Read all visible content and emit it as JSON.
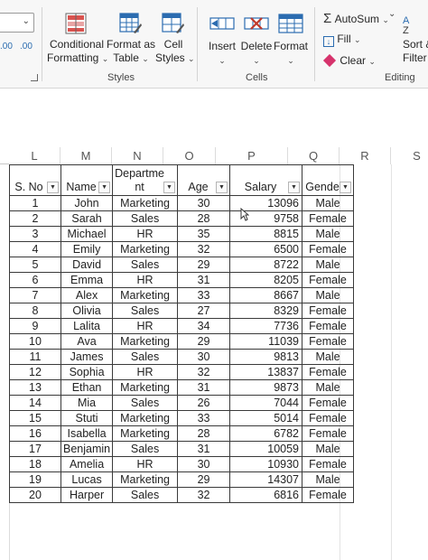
{
  "ribbon": {
    "conditional_formatting": {
      "line1": "Conditional",
      "line2": "Formatting"
    },
    "format_as_table": {
      "line1": "Format as",
      "line2": "Table"
    },
    "cell_styles": {
      "line1": "Cell",
      "line2": "Styles"
    },
    "styles_group_label": "Styles",
    "insert_label": "Insert",
    "delete_label": "Delete",
    "format_label": "Format",
    "cells_group_label": "Cells",
    "autosum_label": "AutoSum",
    "fill_label": "Fill",
    "clear_label": "Clear",
    "sort_filter": {
      "line1": "Sort &",
      "line2": "Filter"
    },
    "editing_group_label": "Editing",
    "number_format_partial": {
      "left": ".00",
      "right": ".00"
    }
  },
  "columns": [
    "L",
    "M",
    "N",
    "O",
    "P",
    "Q",
    "R",
    "S"
  ],
  "table": {
    "headers": [
      {
        "text": "S. No"
      },
      {
        "text": "Name"
      },
      {
        "line1": "Departme",
        "line2": "nt"
      },
      {
        "text": "Age"
      },
      {
        "text": "Salary"
      },
      {
        "text": "Gende"
      }
    ],
    "rows": [
      [
        "1",
        "John",
        "Marketing",
        "30",
        "13096",
        "Male"
      ],
      [
        "2",
        "Sarah",
        "Sales",
        "28",
        "9758",
        "Female"
      ],
      [
        "3",
        "Michael",
        "HR",
        "35",
        "8815",
        "Male"
      ],
      [
        "4",
        "Emily",
        "Marketing",
        "32",
        "6500",
        "Female"
      ],
      [
        "5",
        "David",
        "Sales",
        "29",
        "8722",
        "Male"
      ],
      [
        "6",
        "Emma",
        "HR",
        "31",
        "8205",
        "Female"
      ],
      [
        "7",
        "Alex",
        "Marketing",
        "33",
        "8667",
        "Male"
      ],
      [
        "8",
        "Olivia",
        "Sales",
        "27",
        "8329",
        "Female"
      ],
      [
        "9",
        "Lalita",
        "HR",
        "34",
        "7736",
        "Female"
      ],
      [
        "10",
        "Ava",
        "Marketing",
        "29",
        "11039",
        "Female"
      ],
      [
        "11",
        "James",
        "Sales",
        "30",
        "9813",
        "Male"
      ],
      [
        "12",
        "Sophia",
        "HR",
        "32",
        "13837",
        "Female"
      ],
      [
        "13",
        "Ethan",
        "Marketing",
        "31",
        "9873",
        "Male"
      ],
      [
        "14",
        "Mia",
        "Sales",
        "26",
        "7044",
        "Female"
      ],
      [
        "15",
        "Stuti",
        "Marketing",
        "33",
        "5014",
        "Female"
      ],
      [
        "16",
        "Isabella",
        "Marketing",
        "28",
        "6782",
        "Female"
      ],
      [
        "17",
        "Benjamin",
        "Sales",
        "31",
        "10059",
        "Male"
      ],
      [
        "18",
        "Amelia",
        "HR",
        "30",
        "10930",
        "Female"
      ],
      [
        "19",
        "Lucas",
        "Marketing",
        "29",
        "14307",
        "Male"
      ],
      [
        "20",
        "Harper",
        "Sales",
        "32",
        "6816",
        "Female"
      ]
    ]
  },
  "icons": {
    "conditional_formatting": "conditional-formatting-icon",
    "format_as_table": "format-as-table-icon",
    "cell_styles": "cell-styles-icon",
    "insert": "insert-cells-icon",
    "delete": "delete-cells-icon",
    "format": "format-cells-icon",
    "autosum": "sigma-icon",
    "fill": "fill-down-icon",
    "clear": "eraser-icon",
    "sort_filter": "sort-filter-icon",
    "filter_dropdown": "filter-dropdown-icon",
    "dialog_launcher": "dialog-launcher-icon"
  },
  "colors": {
    "ribbon_bg": "#f7f7f7",
    "icon_blue": "#2b6cb0",
    "icon_red": "#c0392b",
    "table_border": "#3a3a3a"
  }
}
